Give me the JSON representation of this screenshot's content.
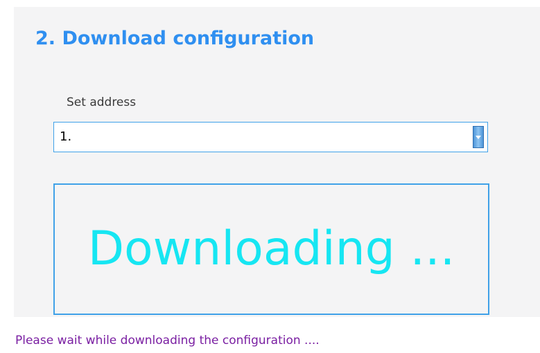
{
  "section": {
    "title": "2. Download configuration"
  },
  "address": {
    "label": "Set address",
    "selected_value": "1.",
    "arrow_icon": "chevron-down-icon"
  },
  "download": {
    "message": "Downloading ..."
  },
  "status": {
    "message": "Please wait while downloading the configuration ...."
  },
  "colors": {
    "title": "#2f8ff0",
    "accent_border": "#3fa1e8",
    "downloading_text": "#16e6f2",
    "status_text": "#7a1fa2",
    "panel_background": "#f4f4f5"
  }
}
